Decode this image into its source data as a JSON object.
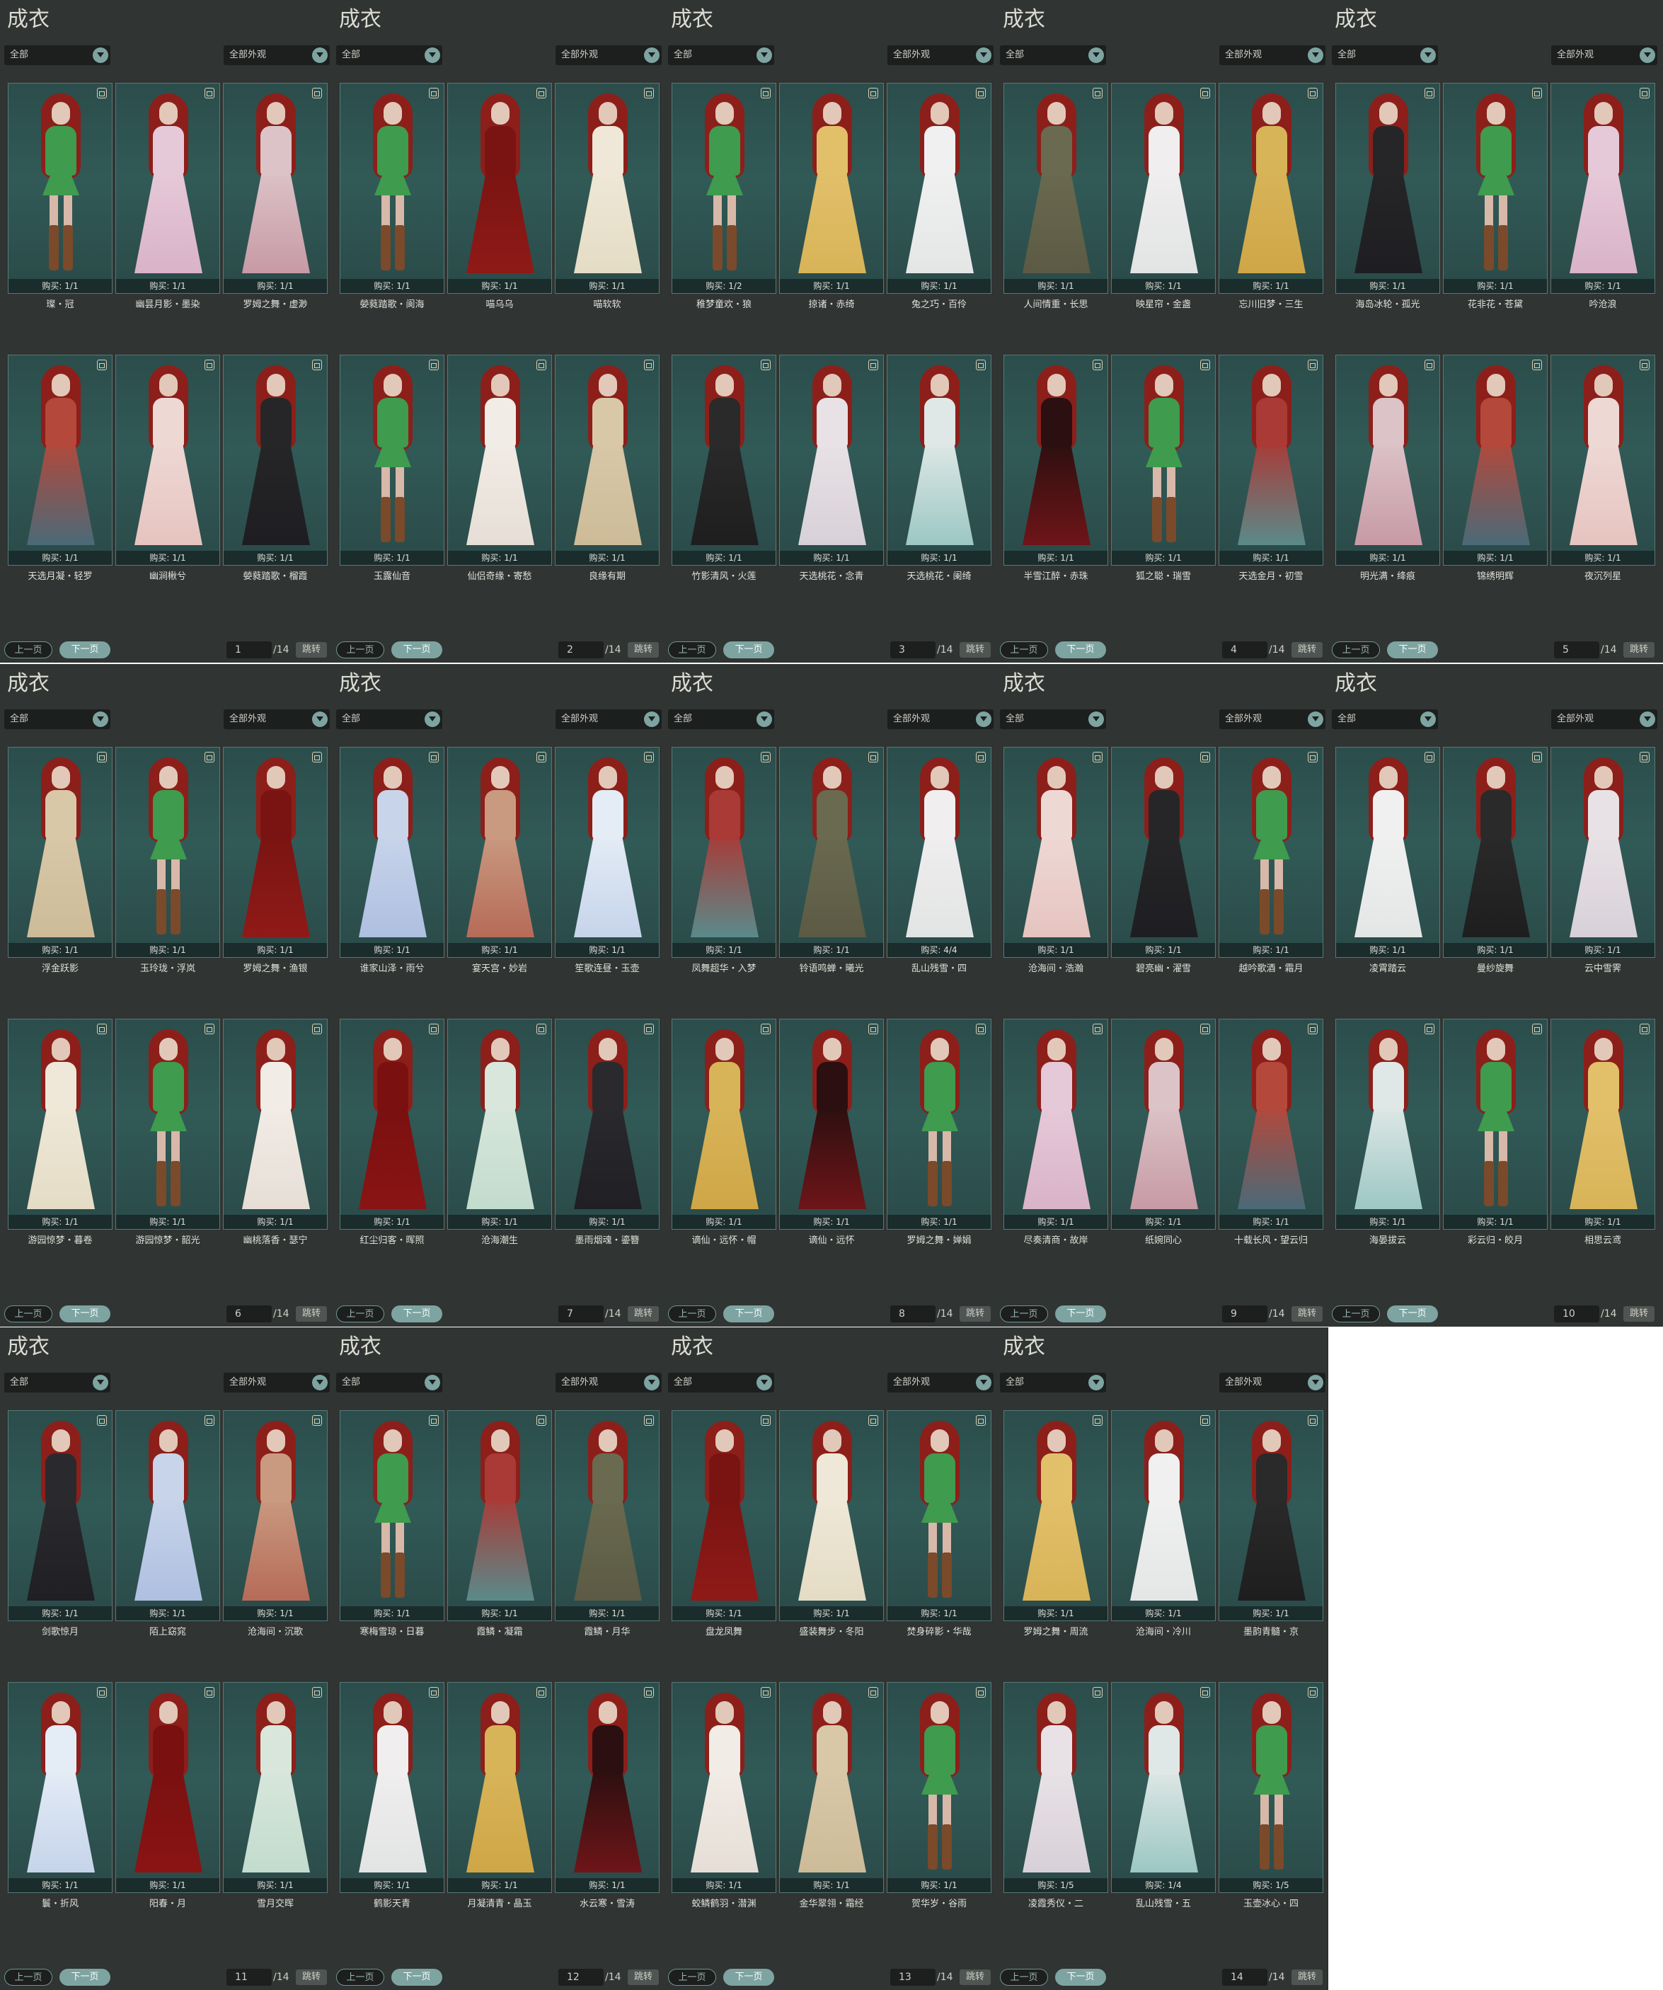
{
  "ui": {
    "title": "成衣",
    "filter_left": "全部",
    "filter_right": "全部外观",
    "prev_label": "上一页",
    "next_label": "下一页",
    "jump_label": "跳转",
    "total_pages": "/14"
  },
  "panels": [
    {
      "page": "1",
      "items": [
        {
          "name": "璨・冠",
          "buy": "购买: 1/1"
        },
        {
          "name": "幽昙月影・墨染",
          "buy": "购买: 1/1"
        },
        {
          "name": "罗姆之舞・虚渺",
          "buy": "购买: 1/1"
        },
        {
          "name": "天选月凝・轻罗",
          "buy": "购买: 1/1"
        },
        {
          "name": "幽涧楸兮",
          "buy": "购买: 1/1"
        },
        {
          "name": "嫈蕤踏歌・榴霞",
          "buy": "购买: 1/1"
        }
      ]
    },
    {
      "page": "2",
      "items": [
        {
          "name": "嫈蕤踏歌・阆海",
          "buy": "购买: 1/1"
        },
        {
          "name": "喵乌乌",
          "buy": "购买: 1/1"
        },
        {
          "name": "喵软软",
          "buy": "购买: 1/1"
        },
        {
          "name": "玉露仙音",
          "buy": "购买: 1/1"
        },
        {
          "name": "仙侣奇缘・寄愁",
          "buy": "购买: 1/1"
        },
        {
          "name": "良缘有期",
          "buy": "购买: 1/1"
        }
      ]
    },
    {
      "page": "3",
      "items": [
        {
          "name": "稚梦童欢・狼",
          "buy": "购买: 1/2"
        },
        {
          "name": "掠诸・赤绮",
          "buy": "购买: 1/1"
        },
        {
          "name": "兔之巧・百伶",
          "buy": "购买: 1/1"
        },
        {
          "name": "竹影清风・火莲",
          "buy": "购买: 1/1"
        },
        {
          "name": "天选桃花・念青",
          "buy": "购买: 1/1"
        },
        {
          "name": "天选桃花・阑绮",
          "buy": "购买: 1/1"
        }
      ]
    },
    {
      "page": "4",
      "items": [
        {
          "name": "人间情重・长思",
          "buy": "购买: 1/1"
        },
        {
          "name": "映星帘・金盏",
          "buy": "购买: 1/1"
        },
        {
          "name": "忘川旧梦・三生",
          "buy": "购买: 1/1"
        },
        {
          "name": "半雪江醉・赤珠",
          "buy": "购买: 1/1"
        },
        {
          "name": "狐之聪・瑞雪",
          "buy": "购买: 1/1"
        },
        {
          "name": "天选金月・初雪",
          "buy": "购买: 1/1"
        }
      ]
    },
    {
      "page": "5",
      "items": [
        {
          "name": "海岛冰轮・孤光",
          "buy": "购买: 1/1"
        },
        {
          "name": "花非花・苍黛",
          "buy": "购买: 1/1"
        },
        {
          "name": "吟沧浪",
          "buy": "购买: 1/1"
        },
        {
          "name": "明光满・绛痕",
          "buy": "购买: 1/1"
        },
        {
          "name": "锦绣明辉",
          "buy": "购买: 1/1"
        },
        {
          "name": "夜沉列星",
          "buy": "购买: 1/1"
        }
      ]
    },
    {
      "page": "6",
      "items": [
        {
          "name": "浮金跃影",
          "buy": "购买: 1/1"
        },
        {
          "name": "玉玲珑・浮岚",
          "buy": "购买: 1/1"
        },
        {
          "name": "罗姆之舞・渔银",
          "buy": "购买: 1/1"
        },
        {
          "name": "游园惊梦・暮卷",
          "buy": "购买: 1/1"
        },
        {
          "name": "游园惊梦・韶光",
          "buy": "购买: 1/1"
        },
        {
          "name": "幽桃落香・瑟宁",
          "buy": "购买: 1/1"
        }
      ]
    },
    {
      "page": "7",
      "items": [
        {
          "name": "谁家山泽・雨兮",
          "buy": "购买: 1/1"
        },
        {
          "name": "宴天宫・妙岩",
          "buy": "购买: 1/1"
        },
        {
          "name": "笙歌连昼・玉壶",
          "buy": "购买: 1/1"
        },
        {
          "name": "红尘归客・晖照",
          "buy": "购买: 1/1"
        },
        {
          "name": "沧海潮生",
          "buy": "购买: 1/1"
        },
        {
          "name": "墨雨烟魂・鎏簪",
          "buy": "购买: 1/1"
        }
      ]
    },
    {
      "page": "8",
      "items": [
        {
          "name": "凤舞超华・入梦",
          "buy": "购买: 1/1"
        },
        {
          "name": "铃语鸣蝉・曦光",
          "buy": "购买: 1/1"
        },
        {
          "name": "乱山残雪・四",
          "buy": "购买: 4/4"
        },
        {
          "name": "谪仙・远怀・帽",
          "buy": "购买: 1/1"
        },
        {
          "name": "谪仙・远怀",
          "buy": "购买: 1/1"
        },
        {
          "name": "罗姆之舞・婵娟",
          "buy": "购买: 1/1"
        }
      ]
    },
    {
      "page": "9",
      "items": [
        {
          "name": "沧海间・浩瀚",
          "buy": "购买: 1/1"
        },
        {
          "name": "碧亮幽・濯雪",
          "buy": "购买: 1/1"
        },
        {
          "name": "越吟歌酒・霜月",
          "buy": "购买: 1/1"
        },
        {
          "name": "尽奏清商・故岸",
          "buy": "购买: 1/1"
        },
        {
          "name": "纸婉同心",
          "buy": "购买: 1/1"
        },
        {
          "name": "十载长风・望云归",
          "buy": "购买: 1/1"
        }
      ]
    },
    {
      "page": "10",
      "items": [
        {
          "name": "凌霄踏云",
          "buy": "购买: 1/1"
        },
        {
          "name": "曼纱旋舞",
          "buy": "购买: 1/1"
        },
        {
          "name": "云中雪霁",
          "buy": "购买: 1/1"
        },
        {
          "name": "海晏拔云",
          "buy": "购买: 1/1"
        },
        {
          "name": "彩云归・皎月",
          "buy": "购买: 1/1"
        },
        {
          "name": "相思云鸢",
          "buy": "购买: 1/1"
        }
      ]
    },
    {
      "page": "11",
      "items": [
        {
          "name": "剑歌惊月",
          "buy": "购买: 1/1"
        },
        {
          "name": "陌上窈窕",
          "buy": "购买: 1/1"
        },
        {
          "name": "沧海间・沉歌",
          "buy": "购买: 1/1"
        },
        {
          "name": "鬟・折风",
          "buy": "购买: 1/1"
        },
        {
          "name": "阳春・月",
          "buy": "购买: 1/1"
        },
        {
          "name": "雪月交晖",
          "buy": "购买: 1/1"
        }
      ]
    },
    {
      "page": "12",
      "items": [
        {
          "name": "寒梅雪琼・日暮",
          "buy": "购买: 1/1"
        },
        {
          "name": "霞鳞・凝霜",
          "buy": "购买: 1/1"
        },
        {
          "name": "霞鳞・月华",
          "buy": "购买: 1/1"
        },
        {
          "name": "鹤影天青",
          "buy": "购买: 1/1"
        },
        {
          "name": "月凝清青・晶玉",
          "buy": "购买: 1/1"
        },
        {
          "name": "水云寒・雪涛",
          "buy": "购买: 1/1"
        }
      ]
    },
    {
      "page": "13",
      "items": [
        {
          "name": "盘龙凤舞",
          "buy": "购买: 1/1"
        },
        {
          "name": "盛装舞步・冬阳",
          "buy": "购买: 1/1"
        },
        {
          "name": "焚身碎影・华哉",
          "buy": "购买: 1/1"
        },
        {
          "name": "蛟鳞鹤羽・潜渊",
          "buy": "购买: 1/1"
        },
        {
          "name": "金华翠翎・霜经",
          "buy": "购买: 1/1"
        },
        {
          "name": "贺华岁・谷雨",
          "buy": "购买: 1/1"
        }
      ]
    },
    {
      "page": "14",
      "items": [
        {
          "name": "罗姆之舞・周流",
          "buy": "购买: 1/1"
        },
        {
          "name": "沧海间・冷川",
          "buy": "购买: 1/1"
        },
        {
          "name": "墨韵青髓・京",
          "buy": "购买: 1/1"
        },
        {
          "name": "凌霞秀仪・二",
          "buy": "购买: 1/5"
        },
        {
          "name": "乱山残雪・五",
          "buy": "购买: 1/4"
        },
        {
          "name": "玉壶冰心・四",
          "buy": "购买: 1/5"
        }
      ]
    }
  ]
}
